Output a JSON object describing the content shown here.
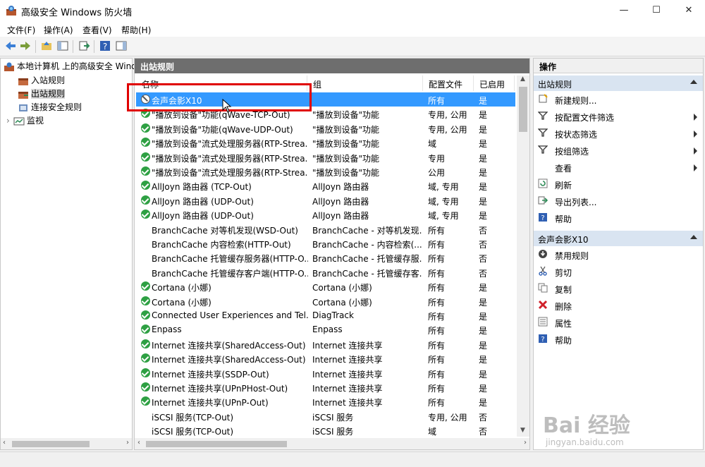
{
  "window": {
    "title": "高级安全 Windows 防火墙",
    "min": "—",
    "max": "☐",
    "close": "✕"
  },
  "menu": [
    "文件(F)",
    "操作(A)",
    "查看(V)",
    "帮助(H)"
  ],
  "tree": {
    "root": "本地计算机 上的高级安全 Wind",
    "items": [
      "入站规则",
      "出站规则",
      "连接安全规则",
      "监视"
    ]
  },
  "center": {
    "title": "出站规则",
    "columns": [
      "名称",
      "组",
      "配置文件",
      "已启用"
    ],
    "rows": [
      {
        "status": "blocked",
        "name": "会声会影X10",
        "group": "",
        "profile": "所有",
        "enabled": "是"
      },
      {
        "status": "ok",
        "name": "\"播放到设备\"功能(qWave-TCP-Out)",
        "group": "\"播放到设备\"功能",
        "profile": "专用, 公用",
        "enabled": "是"
      },
      {
        "status": "ok",
        "name": "\"播放到设备\"功能(qWave-UDP-Out)",
        "group": "\"播放到设备\"功能",
        "profile": "专用, 公用",
        "enabled": "是"
      },
      {
        "status": "ok",
        "name": "\"播放到设备\"流式处理服务器(RTP-Strea...",
        "group": "\"播放到设备\"功能",
        "profile": "域",
        "enabled": "是"
      },
      {
        "status": "ok",
        "name": "\"播放到设备\"流式处理服务器(RTP-Strea...",
        "group": "\"播放到设备\"功能",
        "profile": "专用",
        "enabled": "是"
      },
      {
        "status": "ok",
        "name": "\"播放到设备\"流式处理服务器(RTP-Strea...",
        "group": "\"播放到设备\"功能",
        "profile": "公用",
        "enabled": "是"
      },
      {
        "status": "ok",
        "name": "AllJoyn 路由器 (TCP-Out)",
        "group": "AllJoyn 路由器",
        "profile": "域, 专用",
        "enabled": "是"
      },
      {
        "status": "ok",
        "name": "AllJoyn 路由器 (UDP-Out)",
        "group": "AllJoyn 路由器",
        "profile": "域, 专用",
        "enabled": "是"
      },
      {
        "status": "ok",
        "name": "AllJoyn 路由器 (UDP-Out)",
        "group": "AllJoyn 路由器",
        "profile": "域, 专用",
        "enabled": "是"
      },
      {
        "status": "none",
        "name": "BranchCache 对等机发现(WSD-Out)",
        "group": "BranchCache - 对等机发现...",
        "profile": "所有",
        "enabled": "否"
      },
      {
        "status": "none",
        "name": "BranchCache 内容检索(HTTP-Out)",
        "group": "BranchCache - 内容检索(...",
        "profile": "所有",
        "enabled": "否"
      },
      {
        "status": "none",
        "name": "BranchCache 托管缓存服务器(HTTP-O...",
        "group": "BranchCache - 托管缓存服...",
        "profile": "所有",
        "enabled": "否"
      },
      {
        "status": "none",
        "name": "BranchCache 托管缓存客户端(HTTP-O...",
        "group": "BranchCache - 托管缓存客...",
        "profile": "所有",
        "enabled": "否"
      },
      {
        "status": "ok",
        "name": "Cortana (小娜)",
        "group": "Cortana (小娜)",
        "profile": "所有",
        "enabled": "是"
      },
      {
        "status": "ok",
        "name": "Cortana (小娜)",
        "group": "Cortana (小娜)",
        "profile": "所有",
        "enabled": "是"
      },
      {
        "status": "ok",
        "name": "Connected User Experiences and Tel...",
        "group": "DiagTrack",
        "profile": "所有",
        "enabled": "是"
      },
      {
        "status": "ok",
        "name": "Enpass",
        "group": "Enpass",
        "profile": "所有",
        "enabled": "是"
      },
      {
        "status": "ok",
        "name": "Internet 连接共享(SharedAccess-Out)",
        "group": "Internet 连接共享",
        "profile": "所有",
        "enabled": "是"
      },
      {
        "status": "ok",
        "name": "Internet 连接共享(SharedAccess-Out)",
        "group": "Internet 连接共享",
        "profile": "所有",
        "enabled": "是"
      },
      {
        "status": "ok",
        "name": "Internet 连接共享(SSDP-Out)",
        "group": "Internet 连接共享",
        "profile": "所有",
        "enabled": "是"
      },
      {
        "status": "ok",
        "name": "Internet 连接共享(UPnPHost-Out)",
        "group": "Internet 连接共享",
        "profile": "所有",
        "enabled": "是"
      },
      {
        "status": "ok",
        "name": "Internet 连接共享(UPnP-Out)",
        "group": "Internet 连接共享",
        "profile": "所有",
        "enabled": "是"
      },
      {
        "status": "none",
        "name": "iSCSI 服务(TCP-Out)",
        "group": "iSCSI 服务",
        "profile": "专用, 公用",
        "enabled": "否"
      },
      {
        "status": "none",
        "name": "iSCSI 服务(TCP-Out)",
        "group": "iSCSI 服务",
        "profile": "域",
        "enabled": "否"
      }
    ]
  },
  "actions": {
    "title": "操作",
    "section1": {
      "title": "出站规则",
      "items": [
        {
          "label": "新建规则...",
          "icon": "new-rule-icon",
          "arrow": false
        },
        {
          "label": "按配置文件筛选",
          "icon": "filter-icon",
          "arrow": true
        },
        {
          "label": "按状态筛选",
          "icon": "filter-icon",
          "arrow": true
        },
        {
          "label": "按组筛选",
          "icon": "filter-icon",
          "arrow": true
        },
        {
          "label": "查看",
          "icon": "",
          "arrow": true
        },
        {
          "label": "刷新",
          "icon": "refresh-icon",
          "arrow": false
        },
        {
          "label": "导出列表...",
          "icon": "export-icon",
          "arrow": false
        },
        {
          "label": "帮助",
          "icon": "help-icon",
          "arrow": false
        }
      ]
    },
    "section2": {
      "title": "会声会影X10",
      "items": [
        {
          "label": "禁用规则",
          "icon": "disable-icon",
          "arrow": false
        },
        {
          "label": "剪切",
          "icon": "cut-icon",
          "arrow": false
        },
        {
          "label": "复制",
          "icon": "copy-icon",
          "arrow": false
        },
        {
          "label": "删除",
          "icon": "delete-icon",
          "arrow": false
        },
        {
          "label": "属性",
          "icon": "properties-icon",
          "arrow": false
        },
        {
          "label": "帮助",
          "icon": "help-icon",
          "arrow": false
        }
      ]
    }
  },
  "watermark": {
    "main": "Bai 经验",
    "sub": "jingyan.baidu.com"
  },
  "colors": {
    "selection": "#3399ff",
    "highlight_box": "#e00000",
    "section_header": "#d9e4f1",
    "pane_title": "#6e6e6e"
  }
}
